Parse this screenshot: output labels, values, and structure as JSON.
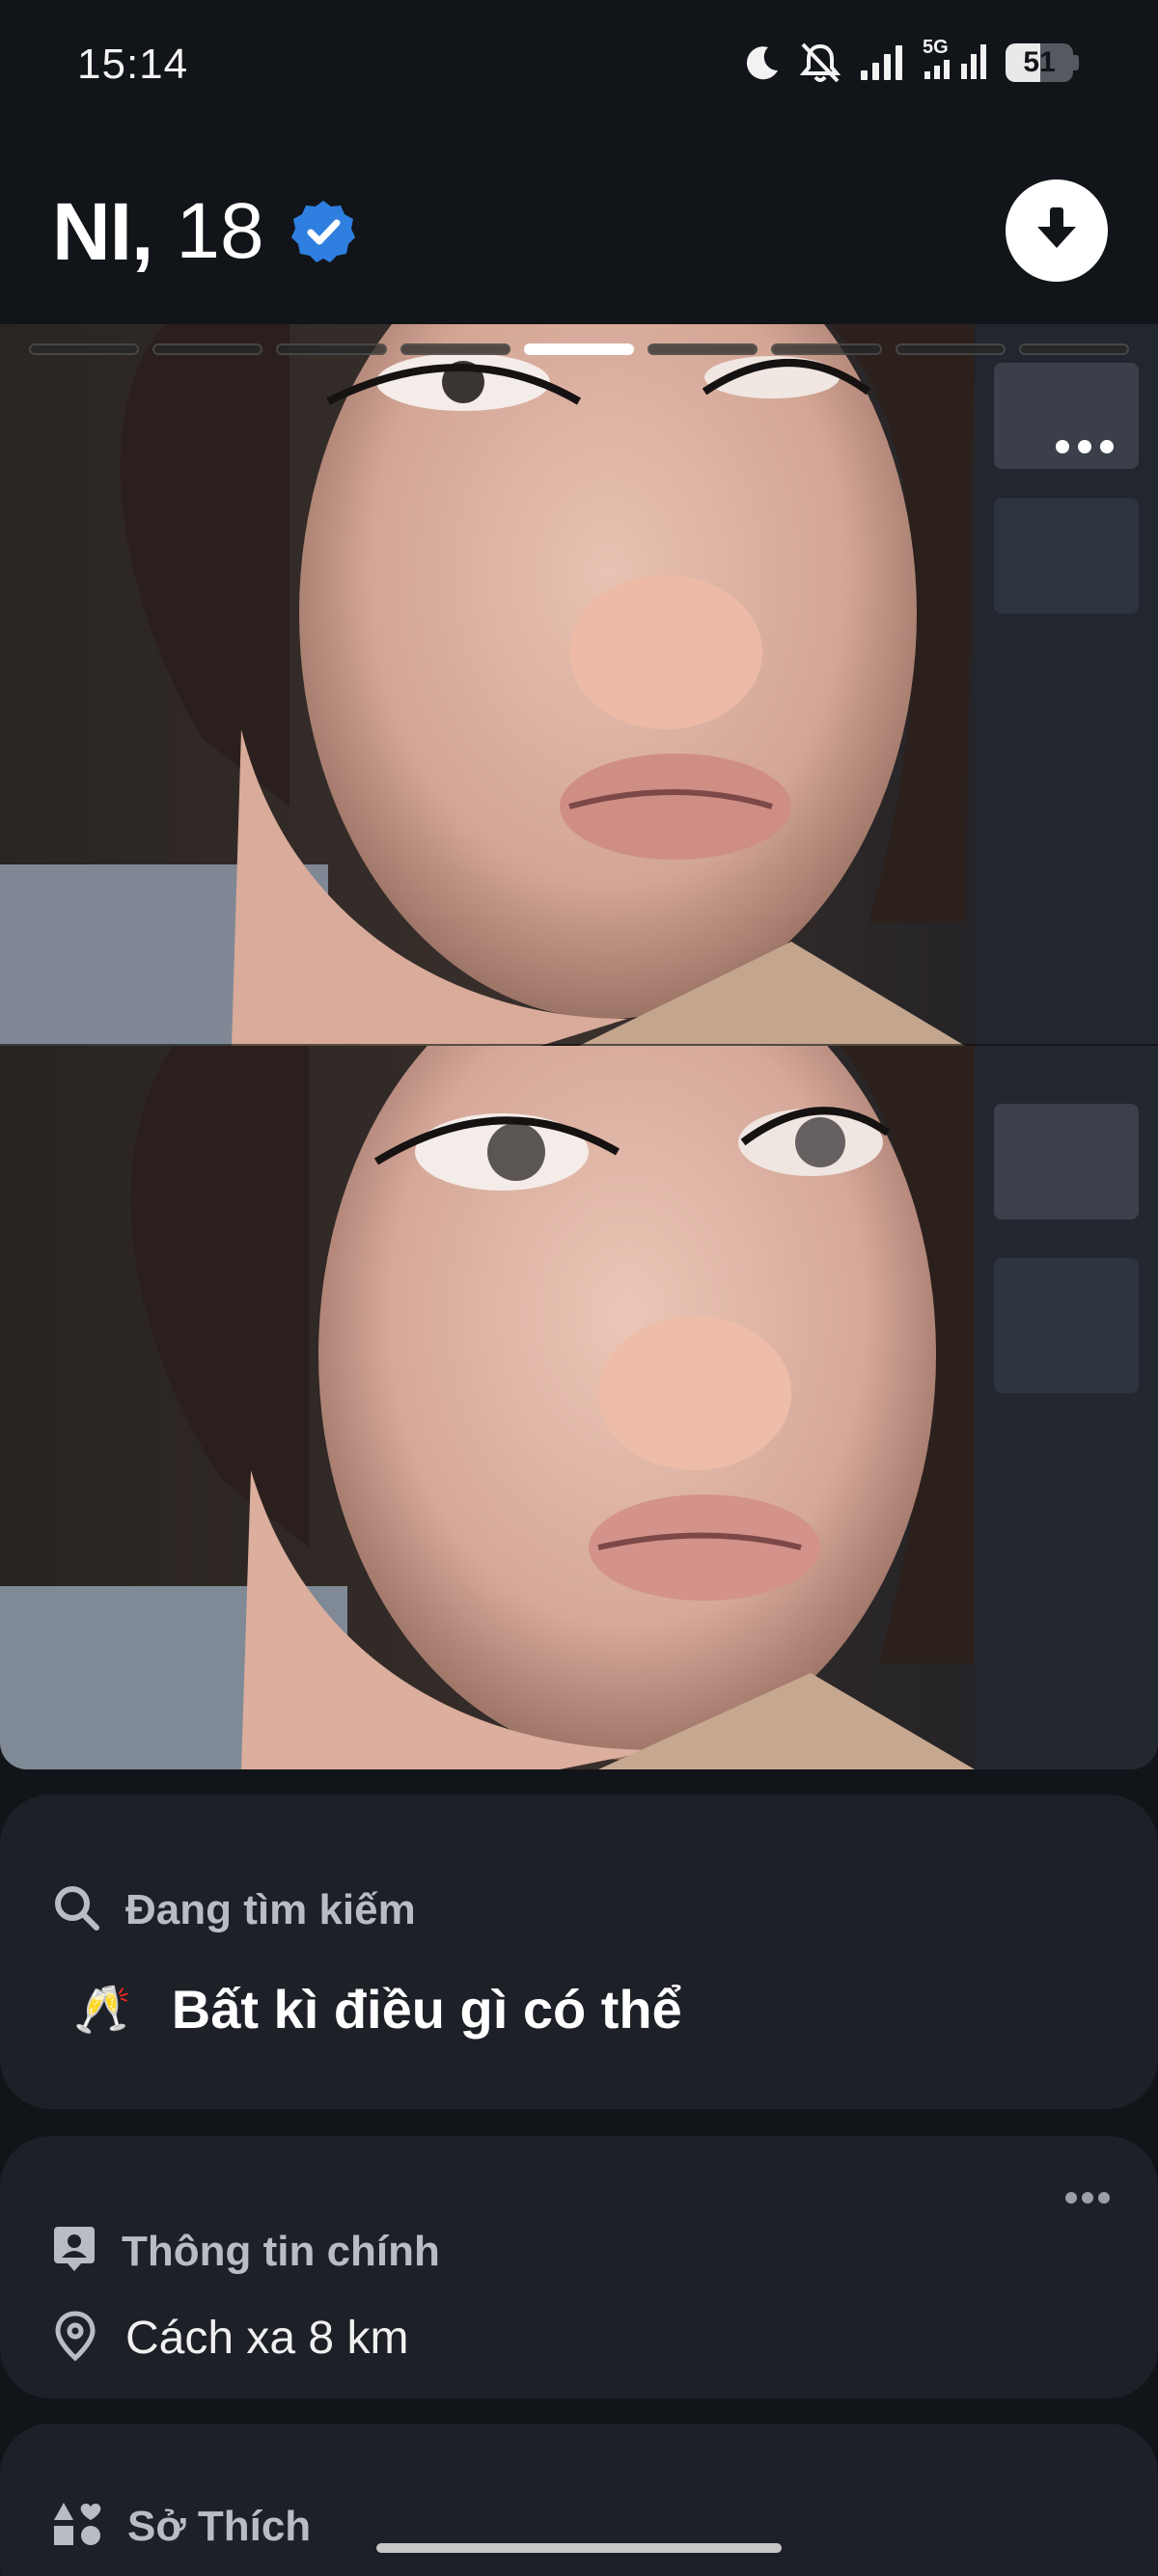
{
  "status_bar": {
    "time": "15:14",
    "network": "5G",
    "battery": "51",
    "battery_fraction": 0.51,
    "icons": [
      "moon-icon",
      "bell-muted-icon",
      "signal-icon",
      "signal-5g-icon",
      "battery-icon"
    ]
  },
  "header": {
    "name": "NI,",
    "age": "18",
    "verified_icon": "verified-badge-icon",
    "download_icon": "arrow-down-icon"
  },
  "photo": {
    "segments_total": 9,
    "active_segment": 5,
    "more_icon": "more-horizontal-icon"
  },
  "looking_for": {
    "label": "Đang tìm kiếm",
    "icon": "search-icon",
    "emoji": "🥂",
    "value": "Bất kì điều gì có thể"
  },
  "main_info": {
    "label": "Thông tin chính",
    "icon": "profile-card-icon",
    "distance_icon": "location-pin-icon",
    "distance": "Cách xa 8 km",
    "more_icon": "more-horizontal-icon"
  },
  "interests": {
    "label": "Sở Thích",
    "icon": "interests-icon"
  },
  "colors": {
    "background": "#111418",
    "card": "#1d2026",
    "verified": "#2f7fe0",
    "label": "#b8bcc4"
  }
}
